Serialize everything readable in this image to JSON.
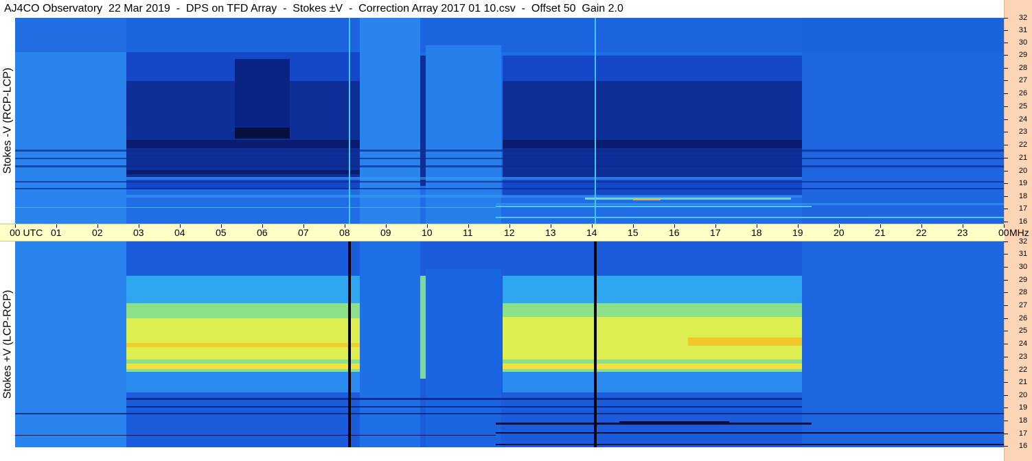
{
  "header": {
    "title": "AJ4CO Observatory  22 Mar 2019  -  DPS on TFD Array  -  Stokes ±V  -  Correction Array 2017 01 10.csv  -  Offset 50  Gain 2.0"
  },
  "panels": {
    "top_label": "Stokes -V (RCP-LCP)",
    "bottom_label": "Stokes +V (LCP-RCP)"
  },
  "time_axis": {
    "labels": [
      "00 UTC",
      "01",
      "02",
      "03",
      "04",
      "05",
      "06",
      "07",
      "08",
      "09",
      "10",
      "11",
      "12",
      "13",
      "14",
      "15",
      "16",
      "17",
      "18",
      "19",
      "20",
      "21",
      "22",
      "23",
      "00"
    ],
    "unit": "MHz"
  },
  "frequency_axis": {
    "labels": [
      "32",
      "31",
      "30",
      "29",
      "28",
      "27",
      "26",
      "25",
      "24",
      "23",
      "22",
      "21",
      "20",
      "19",
      "18",
      "17",
      "16"
    ]
  },
  "colors": {
    "background_level": "#1761e0",
    "strong_negative": "#0a1c6e",
    "strong_positive": "#e6ee3a",
    "time_axis_bg": "#ffffc8",
    "freq_axis_bg": "#fbd5b5"
  }
}
